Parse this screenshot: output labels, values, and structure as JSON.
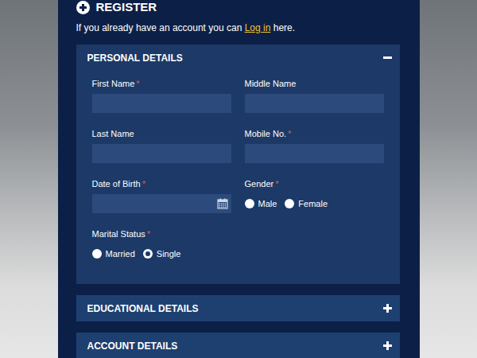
{
  "header": {
    "title": "REGISTER",
    "prompt_before": "If you already have an account you can",
    "login_link": "Log in",
    "prompt_after": "here."
  },
  "required_mark": "*",
  "sections": [
    {
      "title": "PERSONAL DETAILS",
      "expanded": true,
      "fields": [
        {
          "label": "First Name",
          "required": true,
          "kind": "text",
          "value": ""
        },
        {
          "label": "Middle Name",
          "required": false,
          "kind": "text",
          "value": ""
        },
        {
          "label": "Last Name",
          "required": false,
          "kind": "text",
          "value": ""
        },
        {
          "label": "Mobile No.",
          "required": true,
          "kind": "text",
          "value": ""
        },
        {
          "label": "Date of Birth",
          "required": true,
          "kind": "date",
          "value": ""
        },
        {
          "label": "Gender",
          "required": true,
          "kind": "radio",
          "options": [
            {
              "label": "Male",
              "selected": false
            },
            {
              "label": "Female",
              "selected": false
            }
          ]
        },
        {
          "label": "Marital Status",
          "required": true,
          "kind": "radio",
          "options": [
            {
              "label": "Married",
              "selected": false
            },
            {
              "label": "Single",
              "selected": true
            }
          ]
        }
      ]
    },
    {
      "title": "EDUCATIONAL DETAILS",
      "expanded": false,
      "fields": []
    },
    {
      "title": "ACCOUNT DETAILS",
      "expanded": false,
      "fields": []
    }
  ]
}
